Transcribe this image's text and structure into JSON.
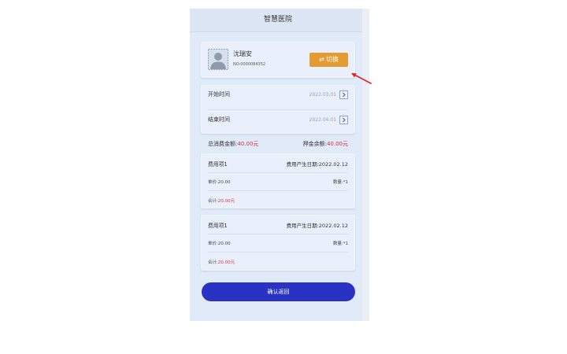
{
  "app": {
    "title": "智慧医院"
  },
  "patient": {
    "name": "沈瑞安",
    "no": "NO:0000084352",
    "switch_icon": "⇄",
    "switch_label": "切换"
  },
  "period": {
    "start_label": "开始时间",
    "start_value": "2022.03.01",
    "end_label": "结束时间",
    "end_value": "2022.04.01"
  },
  "summary": {
    "total_label": "总消费金额:",
    "total_value": "40.00元",
    "deposit_label": "押金余额:",
    "deposit_value": "40.00元"
  },
  "fees": [
    {
      "name": "费用项1",
      "date": "费用产生日期:2022.02.12",
      "unit_price": "单价:20.00",
      "quantity": "数量:*1",
      "subtotal_label": "合计:",
      "subtotal_value": "20.00元"
    },
    {
      "name": "费用项1",
      "date": "费用产生日期:2022.02.12",
      "unit_price": "单价:20.00",
      "quantity": "数量:*1",
      "subtotal_label": "合计:",
      "subtotal_value": "20.00元"
    }
  ],
  "confirm_label": "确认返回",
  "icons": {
    "avatar": "avatar-icon",
    "switch": "swap-icon",
    "date_picker": "chevron-right-icon",
    "annotation": "red-arrow-annotation"
  },
  "colors": {
    "header_bg": "#dce6f5",
    "switch_button": "#e39b32",
    "amount": "#d6323a",
    "confirm_button": "#2a32c3",
    "annotation_arrow": "#e3262a"
  }
}
